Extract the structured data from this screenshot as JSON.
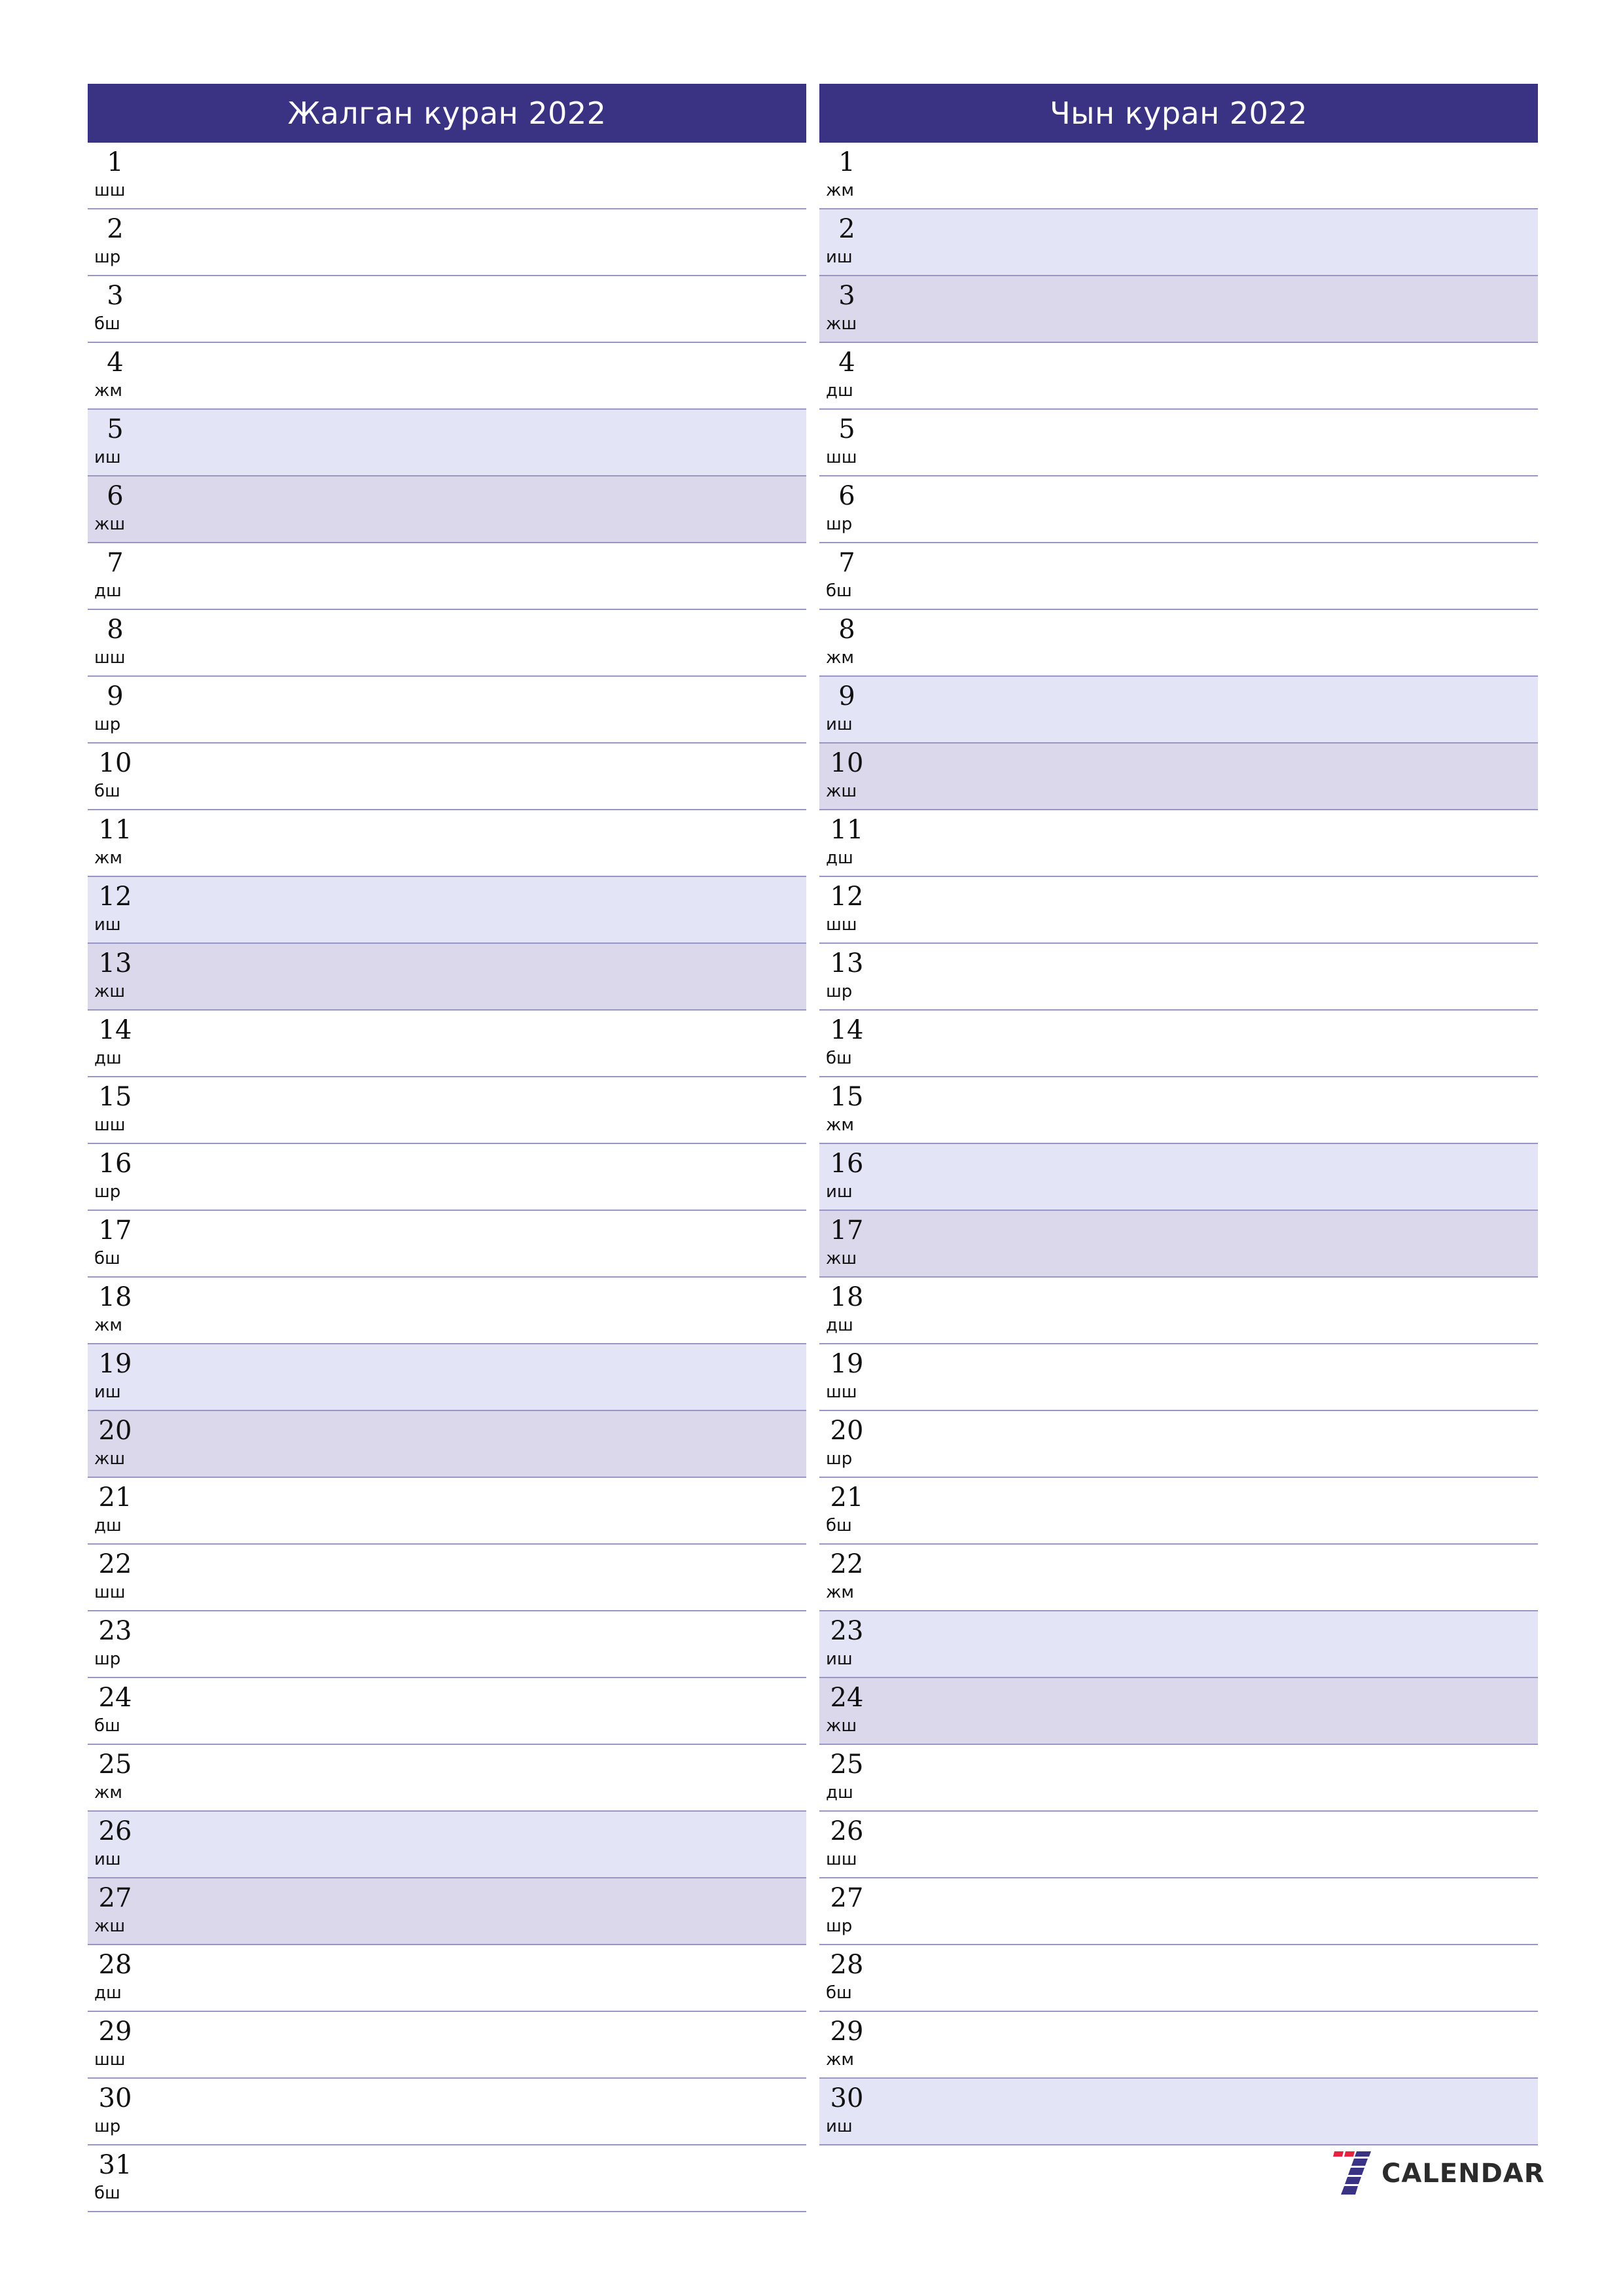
{
  "colors": {
    "header_bg": "#3a3384",
    "saturday_bg": "#e4e4f7",
    "sunday_bg": "#dcd8ec",
    "divider": "#9a96c4",
    "logo_red": "#e8213f",
    "logo_blue": "#3a3384"
  },
  "months": [
    {
      "title": "Жалган куран 2022",
      "days": [
        {
          "n": "1",
          "dow": "шш",
          "type": "weekday"
        },
        {
          "n": "2",
          "dow": "шр",
          "type": "weekday"
        },
        {
          "n": "3",
          "dow": "бш",
          "type": "weekday"
        },
        {
          "n": "4",
          "dow": "жм",
          "type": "weekday"
        },
        {
          "n": "5",
          "dow": "иш",
          "type": "sat"
        },
        {
          "n": "6",
          "dow": "жш",
          "type": "sun"
        },
        {
          "n": "7",
          "dow": "дш",
          "type": "weekday"
        },
        {
          "n": "8",
          "dow": "шш",
          "type": "weekday"
        },
        {
          "n": "9",
          "dow": "шр",
          "type": "weekday"
        },
        {
          "n": "10",
          "dow": "бш",
          "type": "weekday"
        },
        {
          "n": "11",
          "dow": "жм",
          "type": "weekday"
        },
        {
          "n": "12",
          "dow": "иш",
          "type": "sat"
        },
        {
          "n": "13",
          "dow": "жш",
          "type": "sun"
        },
        {
          "n": "14",
          "dow": "дш",
          "type": "weekday"
        },
        {
          "n": "15",
          "dow": "шш",
          "type": "weekday"
        },
        {
          "n": "16",
          "dow": "шр",
          "type": "weekday"
        },
        {
          "n": "17",
          "dow": "бш",
          "type": "weekday"
        },
        {
          "n": "18",
          "dow": "жм",
          "type": "weekday"
        },
        {
          "n": "19",
          "dow": "иш",
          "type": "sat"
        },
        {
          "n": "20",
          "dow": "жш",
          "type": "sun"
        },
        {
          "n": "21",
          "dow": "дш",
          "type": "weekday"
        },
        {
          "n": "22",
          "dow": "шш",
          "type": "weekday"
        },
        {
          "n": "23",
          "dow": "шр",
          "type": "weekday"
        },
        {
          "n": "24",
          "dow": "бш",
          "type": "weekday"
        },
        {
          "n": "25",
          "dow": "жм",
          "type": "weekday"
        },
        {
          "n": "26",
          "dow": "иш",
          "type": "sat"
        },
        {
          "n": "27",
          "dow": "жш",
          "type": "sun"
        },
        {
          "n": "28",
          "dow": "дш",
          "type": "weekday"
        },
        {
          "n": "29",
          "dow": "шш",
          "type": "weekday"
        },
        {
          "n": "30",
          "dow": "шр",
          "type": "weekday"
        },
        {
          "n": "31",
          "dow": "бш",
          "type": "weekday"
        }
      ]
    },
    {
      "title": "Чын куран 2022",
      "days": [
        {
          "n": "1",
          "dow": "жм",
          "type": "weekday"
        },
        {
          "n": "2",
          "dow": "иш",
          "type": "sat"
        },
        {
          "n": "3",
          "dow": "жш",
          "type": "sun"
        },
        {
          "n": "4",
          "dow": "дш",
          "type": "weekday"
        },
        {
          "n": "5",
          "dow": "шш",
          "type": "weekday"
        },
        {
          "n": "6",
          "dow": "шр",
          "type": "weekday"
        },
        {
          "n": "7",
          "dow": "бш",
          "type": "weekday"
        },
        {
          "n": "8",
          "dow": "жм",
          "type": "weekday"
        },
        {
          "n": "9",
          "dow": "иш",
          "type": "sat"
        },
        {
          "n": "10",
          "dow": "жш",
          "type": "sun"
        },
        {
          "n": "11",
          "dow": "дш",
          "type": "weekday"
        },
        {
          "n": "12",
          "dow": "шш",
          "type": "weekday"
        },
        {
          "n": "13",
          "dow": "шр",
          "type": "weekday"
        },
        {
          "n": "14",
          "dow": "бш",
          "type": "weekday"
        },
        {
          "n": "15",
          "dow": "жм",
          "type": "weekday"
        },
        {
          "n": "16",
          "dow": "иш",
          "type": "sat"
        },
        {
          "n": "17",
          "dow": "жш",
          "type": "sun"
        },
        {
          "n": "18",
          "dow": "дш",
          "type": "weekday"
        },
        {
          "n": "19",
          "dow": "шш",
          "type": "weekday"
        },
        {
          "n": "20",
          "dow": "шр",
          "type": "weekday"
        },
        {
          "n": "21",
          "dow": "бш",
          "type": "weekday"
        },
        {
          "n": "22",
          "dow": "жм",
          "type": "weekday"
        },
        {
          "n": "23",
          "dow": "иш",
          "type": "sat"
        },
        {
          "n": "24",
          "dow": "жш",
          "type": "sun"
        },
        {
          "n": "25",
          "dow": "дш",
          "type": "weekday"
        },
        {
          "n": "26",
          "dow": "шш",
          "type": "weekday"
        },
        {
          "n": "27",
          "dow": "шр",
          "type": "weekday"
        },
        {
          "n": "28",
          "dow": "бш",
          "type": "weekday"
        },
        {
          "n": "29",
          "dow": "жм",
          "type": "weekday"
        },
        {
          "n": "30",
          "dow": "иш",
          "type": "sat"
        }
      ]
    }
  ],
  "logo": {
    "icon": "seven-calendar-icon",
    "text": "CALENDAR"
  }
}
